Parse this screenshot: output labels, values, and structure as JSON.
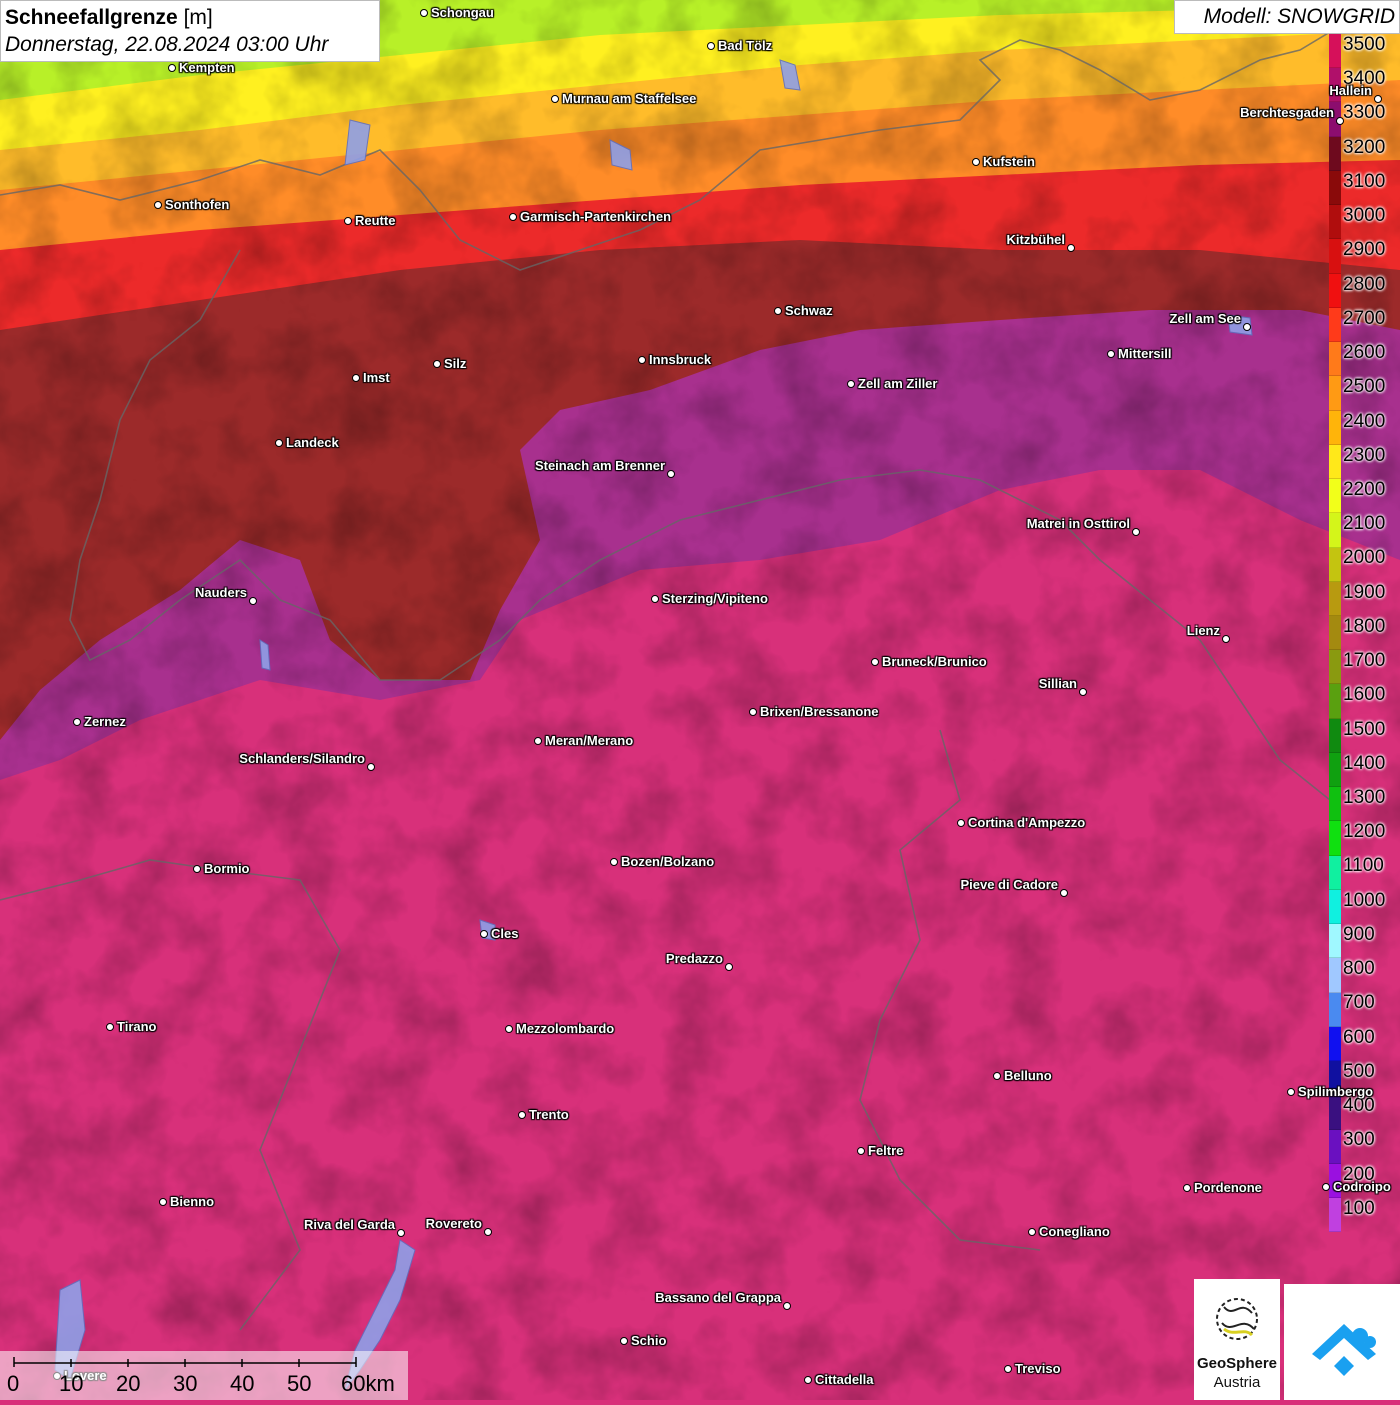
{
  "header": {
    "title": "Schneefallgrenze",
    "unit": "[m]",
    "datetime": "Donnerstag, 22.08.2024 03:00 Uhr",
    "model": "Modell: SNOWGRID"
  },
  "legend": {
    "labels": [
      "3500",
      "3400",
      "3300",
      "3200",
      "3100",
      "3000",
      "2900",
      "2800",
      "2700",
      "2600",
      "2500",
      "2400",
      "2300",
      "2200",
      "2100",
      "2000",
      "1900",
      "1800",
      "1700",
      "1600",
      "1500",
      "1400",
      "1300",
      "1200",
      "1100",
      "1000",
      "900",
      "800",
      "700",
      "600",
      "500",
      "400",
      "300",
      "200",
      "100"
    ],
    "colors": [
      "#d6105a",
      "#b0106a",
      "#8c0d6e",
      "#6e0a1e",
      "#8a0a0a",
      "#b00d0d",
      "#d81010",
      "#f01010",
      "#ff3a1a",
      "#ff7a1a",
      "#ff9a14",
      "#ffb40a",
      "#ffe81a",
      "#f2ff1a",
      "#d4f51a",
      "#c4c410",
      "#b89a10",
      "#a48a10",
      "#8a9a10",
      "#5aa010",
      "#108a10",
      "#10a010",
      "#10c010",
      "#10e010",
      "#10f0a0",
      "#10f0e0",
      "#a0f8ff",
      "#a0c8ff",
      "#4a8af0",
      "#1010f0",
      "#1010a0",
      "#3a1080",
      "#6a10c0",
      "#9a10e0",
      "#c040e0"
    ]
  },
  "map_colors": {
    "yellow_green": "#b8f028",
    "yellow": "#fff020",
    "orange_light": "#ffbc2a",
    "orange": "#ff8a2a",
    "red": "#f02a2a",
    "dark_red": "#9a2828",
    "purple": "#a0308a",
    "magenta": "#d8307a"
  },
  "cities": [
    {
      "name": "Schongau"
    },
    {
      "name": "Bad Tölz"
    },
    {
      "name": "Kempten"
    },
    {
      "name": "Murnau am Staffelsee"
    },
    {
      "name": "Hallein"
    },
    {
      "name": "Berchtesgaden"
    },
    {
      "name": "Kufstein"
    },
    {
      "name": "Sonthofen"
    },
    {
      "name": "Reutte"
    },
    {
      "name": "Garmisch-Partenkirchen"
    },
    {
      "name": "Kitzbühel"
    },
    {
      "name": "Schwaz"
    },
    {
      "name": "Zell am See"
    },
    {
      "name": "Mittersill"
    },
    {
      "name": "Innsbruck"
    },
    {
      "name": "Silz"
    },
    {
      "name": "Imst"
    },
    {
      "name": "Zell am Ziller"
    },
    {
      "name": "Landeck"
    },
    {
      "name": "Steinach am Brenner"
    },
    {
      "name": "Matrei in Osttirol"
    },
    {
      "name": "Nauders"
    },
    {
      "name": "Sterzing/Vipiteno"
    },
    {
      "name": "Lienz"
    },
    {
      "name": "Bruneck/Brunico"
    },
    {
      "name": "Sillian"
    },
    {
      "name": "Brixen/Bressanone"
    },
    {
      "name": "Zernez"
    },
    {
      "name": "Meran/Merano"
    },
    {
      "name": "Schlanders/Silandro"
    },
    {
      "name": "Cortina d'Ampezzo"
    },
    {
      "name": "Bozen/Bolzano"
    },
    {
      "name": "Bormio"
    },
    {
      "name": "Pieve di Cadore"
    },
    {
      "name": "Cles"
    },
    {
      "name": "Predazzo"
    },
    {
      "name": "Tirano"
    },
    {
      "name": "Mezzolombardo"
    },
    {
      "name": "Belluno"
    },
    {
      "name": "Spilimbergo"
    },
    {
      "name": "Trento"
    },
    {
      "name": "Feltre"
    },
    {
      "name": "Pordenone"
    },
    {
      "name": "Bienno"
    },
    {
      "name": "Riva del Garda"
    },
    {
      "name": "Rovereto"
    },
    {
      "name": "Conegliano"
    },
    {
      "name": "Bassano del Grappa"
    },
    {
      "name": "Schio"
    },
    {
      "name": "Treviso"
    },
    {
      "name": "Cittadella"
    },
    {
      "name": "Lovere"
    },
    {
      "name": "Codroipo"
    }
  ],
  "scale": {
    "labels": [
      "0",
      "10",
      "20",
      "30",
      "40",
      "50",
      "60km"
    ]
  },
  "logo": {
    "name_line1": "GeoSphere",
    "name_line2": "Austria"
  }
}
